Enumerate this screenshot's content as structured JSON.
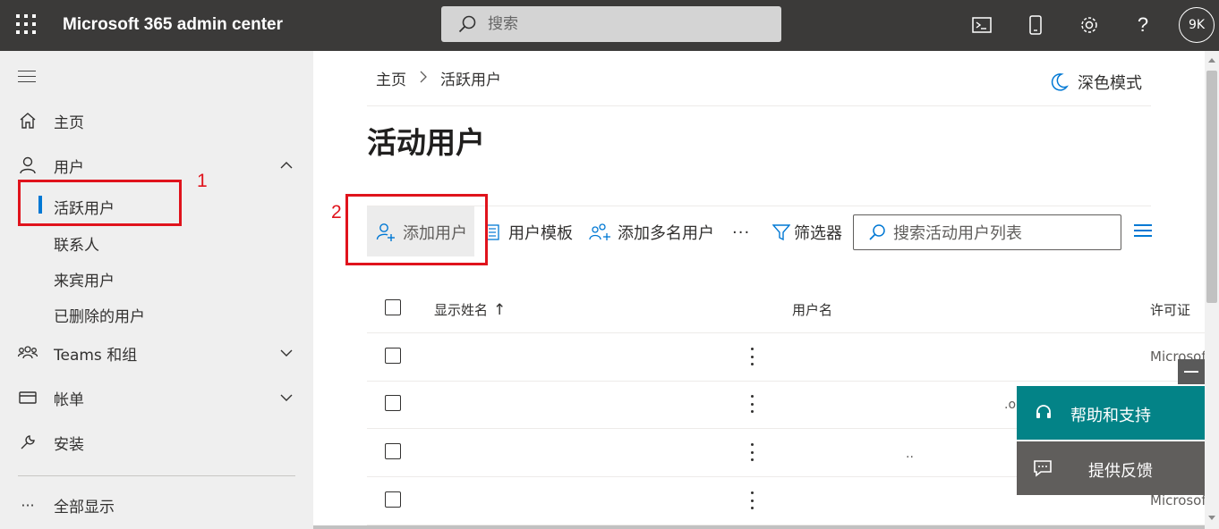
{
  "topbar": {
    "app_title": "Microsoft 365 admin center",
    "search_placeholder": "搜索",
    "avatar_initials": "9K",
    "icons": [
      "waffle-icon",
      "cloud-shell-icon",
      "mobile-app-icon",
      "gear-icon",
      "help-icon"
    ]
  },
  "sidebar": {
    "home": "主页",
    "users": "用户",
    "users_sub": [
      "活跃用户",
      "联系人",
      "来宾用户",
      "已删除的用户"
    ],
    "teams": "Teams 和组",
    "billing": "帐单",
    "setup": "安装",
    "show_all": "全部显示"
  },
  "annotations": {
    "box1_number": "1",
    "box2_number": "2",
    "color": "#e0131c"
  },
  "breadcrumb": {
    "home": "主页",
    "current": "活跃用户"
  },
  "dark_mode_label": "深色模式",
  "page_title": "活动用户",
  "commands": {
    "add_user": "添加用户",
    "user_templates": "用户模板",
    "add_multiple": "添加多名用户",
    "more": "···",
    "filter": "筛选器"
  },
  "list_search_placeholder": "搜索活动用户列表",
  "table": {
    "headers": {
      "display_name": "显示姓名",
      "sort_arrow": "↑",
      "username": "用户名",
      "license": "许可证"
    },
    "rows": [
      {
        "license": "Microsoft",
        "frag": ""
      },
      {
        "license": "",
        "frag": ".on"
      },
      {
        "license": "",
        "frag": ".."
      },
      {
        "license": "Microsoft",
        "frag": ""
      }
    ]
  },
  "help_panel": {
    "help_label": "帮助和支持",
    "feedback_label": "提供反馈"
  },
  "colors": {
    "accent": "#0078d4",
    "topbar": "#3b3a39",
    "help": "#038387",
    "feedback": "#605e5c"
  }
}
